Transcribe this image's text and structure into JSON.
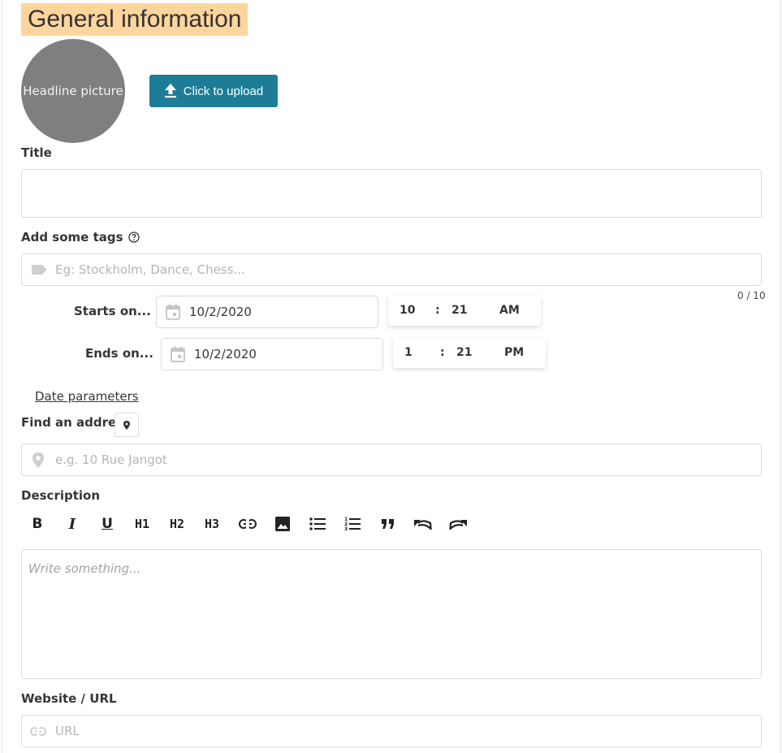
{
  "section_title": "General information",
  "headline_picture": {
    "label": "Headline picture"
  },
  "upload": {
    "label": "Click to upload",
    "icon": "upload-icon"
  },
  "title_field": {
    "label": "Title",
    "value": ""
  },
  "tags_field": {
    "label": "Add some tags",
    "placeholder": "Eg: Stockholm, Dance, Chess...",
    "counter": "0 / 10",
    "icon": "tag-icon",
    "help_icon": "help-circle-icon"
  },
  "starts": {
    "label": "Starts on...",
    "date": "10/2/2020",
    "hour": "10",
    "sep": ":",
    "minute": "21",
    "period": "AM"
  },
  "ends": {
    "label": "Ends on...",
    "date": "10/2/2020",
    "hour": "1",
    "sep": ":",
    "minute": "21",
    "period": "PM"
  },
  "date_parameters_link": "Date parameters",
  "address": {
    "label": "Find an address",
    "placeholder": "e.g. 10 Rue Jangot",
    "icon": "map-pin-icon"
  },
  "description": {
    "label": "Description",
    "placeholder": "Write something...",
    "toolbar": [
      {
        "name": "bold",
        "label": "B"
      },
      {
        "name": "italic",
        "label": "I"
      },
      {
        "name": "underline",
        "label": "U"
      },
      {
        "name": "heading-1",
        "label": "H1"
      },
      {
        "name": "heading-2",
        "label": "H2"
      },
      {
        "name": "heading-3",
        "label": "H3"
      },
      {
        "name": "link",
        "label": ""
      },
      {
        "name": "image",
        "label": ""
      },
      {
        "name": "bullet-list",
        "label": ""
      },
      {
        "name": "ordered-list",
        "label": ""
      },
      {
        "name": "blockquote",
        "label": ""
      },
      {
        "name": "undo",
        "label": ""
      },
      {
        "name": "redo",
        "label": ""
      }
    ]
  },
  "website": {
    "label": "Website / URL",
    "placeholder": "URL",
    "icon": "link-icon"
  },
  "colors": {
    "accent": "#1e7d96",
    "highlight": "#ffd59e",
    "avatar": "#7f7f7f",
    "border": "#dbdbdb"
  }
}
